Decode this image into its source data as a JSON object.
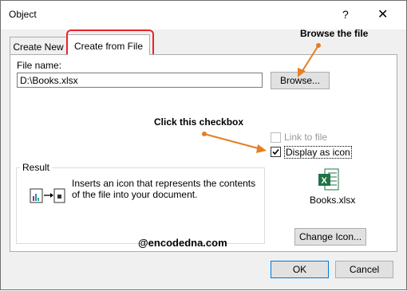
{
  "window": {
    "title": "Object",
    "help_glyph": "?",
    "close_glyph": "✕"
  },
  "tabs": [
    {
      "label": "Create New",
      "active": false
    },
    {
      "label": "Create from File",
      "active": true
    }
  ],
  "file_name": {
    "label": "File name:",
    "value": "D:\\Books.xlsx"
  },
  "browse_button": "Browse...",
  "link_to_file": {
    "label": "Link to file",
    "checked": false,
    "enabled": false
  },
  "display_as_icon": {
    "label": "Display as icon",
    "checked": true
  },
  "result": {
    "title": "Result",
    "text_line1": "Inserts an icon that represents the contents",
    "text_line2": "of the file into your document."
  },
  "file_icon": {
    "icon": "excel-file-icon",
    "caption": "Books.xlsx"
  },
  "change_icon_button": "Change Icon...",
  "ok_button": "OK",
  "cancel_button": "Cancel",
  "annotations": {
    "browse_note": "Browse the file",
    "checkbox_note": "Click this checkbox",
    "watermark": "@encodedna.com",
    "color": "#e67e22"
  }
}
